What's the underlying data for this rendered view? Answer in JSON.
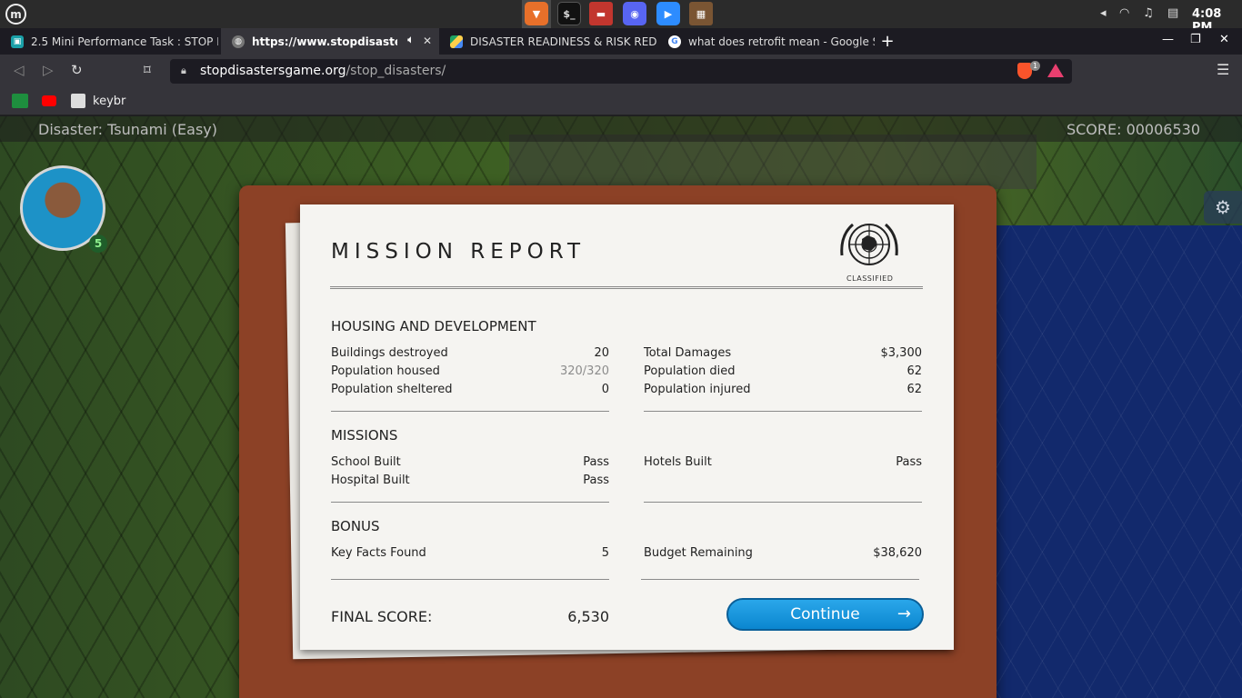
{
  "system": {
    "clock": "4:08 PM",
    "apps": [
      "brave",
      "terminal",
      "files",
      "discord",
      "zoom",
      "minecraft"
    ]
  },
  "browser": {
    "tabs": [
      {
        "label": "2.5 Mini Performance Task : STOP D",
        "active": false
      },
      {
        "label": "https://www.stopdisasters",
        "active": true
      },
      {
        "label": "DISASTER READINESS & RISK REDU",
        "active": false
      },
      {
        "label": "what does retrofit mean - Google S",
        "active": false
      }
    ],
    "url_host": "stopdisastersgame.org",
    "url_path": "/stop_disasters/",
    "shield_count": "1",
    "bookmarks": [
      {
        "label": "keybr"
      }
    ]
  },
  "game": {
    "disaster": "Disaster: Tsunami (Easy)",
    "score": "SCORE: 00006530",
    "advisor_level": "5"
  },
  "report": {
    "title": "MISSION REPORT",
    "classified": "CLASSIFIED",
    "housing": {
      "heading": "HOUSING AND DEVELOPMENT",
      "left": [
        {
          "label": "Buildings destroyed",
          "value": "20"
        },
        {
          "label": "Population housed",
          "value": "320/320"
        },
        {
          "label": "Population sheltered",
          "value": "0"
        }
      ],
      "right": [
        {
          "label": "Total Damages",
          "value": "$3,300"
        },
        {
          "label": "Population died",
          "value": "62"
        },
        {
          "label": "Population injured",
          "value": "62"
        }
      ]
    },
    "missions": {
      "heading": "MISSIONS",
      "left": [
        {
          "label": "School Built",
          "value": "Pass"
        },
        {
          "label": "Hospital Built",
          "value": "Pass"
        }
      ],
      "right": [
        {
          "label": "Hotels Built",
          "value": "Pass"
        }
      ]
    },
    "bonus": {
      "heading": "BONUS",
      "left": [
        {
          "label": "Key Facts Found",
          "value": "5"
        }
      ],
      "right": [
        {
          "label": "Budget Remaining",
          "value": "$38,620"
        }
      ]
    },
    "final_score_label": "FINAL SCORE:",
    "final_score_value": "6,530",
    "continue_label": "Continue"
  },
  "colors": {
    "continue_button": "#0b86cf",
    "clipboard": "#8c4126",
    "paper": "#f5f4f1",
    "sea": "#12296c"
  }
}
